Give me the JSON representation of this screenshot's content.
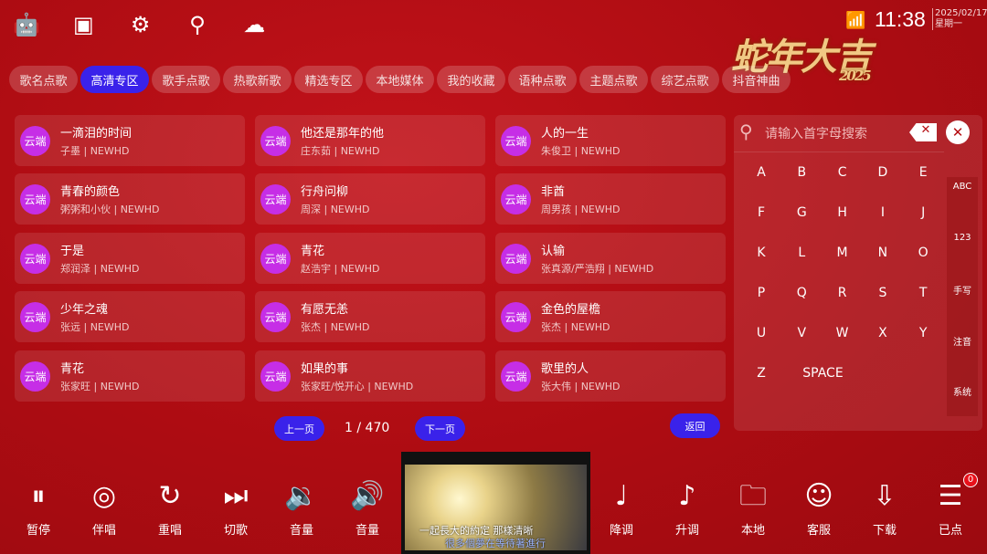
{
  "status": {
    "time": "11:38",
    "date": "2025/02/17",
    "weekday": "星期一"
  },
  "logo": {
    "text": "蛇年大吉",
    "year": "2025"
  },
  "top_icons": [
    "android-icon",
    "cube-icon",
    "gear-icon",
    "search-icon",
    "cloud-download-icon"
  ],
  "tabs": [
    {
      "label": "歌名点歌"
    },
    {
      "label": "高清专区",
      "active": true
    },
    {
      "label": "歌手点歌"
    },
    {
      "label": "热歌新歌"
    },
    {
      "label": "精选专区"
    },
    {
      "label": "本地媒体"
    },
    {
      "label": "我的收藏"
    },
    {
      "label": "语种点歌"
    },
    {
      "label": "主题点歌"
    },
    {
      "label": "综艺点歌"
    },
    {
      "label": "抖音神曲"
    }
  ],
  "badge_label": "云端",
  "songs": [
    {
      "title": "一滴泪的时间",
      "sub": "子墨 | NEWHD"
    },
    {
      "title": "他还是那年的他",
      "sub": "庄东茹 | NEWHD"
    },
    {
      "title": "人的一生",
      "sub": "朱俊卫 | NEWHD"
    },
    {
      "title": "青春的颜色",
      "sub": "粥粥和小伙 | NEWHD"
    },
    {
      "title": "行舟问柳",
      "sub": "周深 | NEWHD"
    },
    {
      "title": "非酋",
      "sub": "周男孩 | NEWHD"
    },
    {
      "title": "于是",
      "sub": "郑润泽 | NEWHD"
    },
    {
      "title": "青花",
      "sub": "赵浩宇 | NEWHD"
    },
    {
      "title": "认输",
      "sub": "张真源/严浩翔 | NEWHD"
    },
    {
      "title": "少年之魂",
      "sub": "张远 | NEWHD"
    },
    {
      "title": "有愿无恙",
      "sub": "张杰 | NEWHD"
    },
    {
      "title": "金色的屋檐",
      "sub": "张杰 | NEWHD"
    },
    {
      "title": "青花",
      "sub": "张家旺 | NEWHD"
    },
    {
      "title": "如果的事",
      "sub": "张家旺/悦开心 | NEWHD"
    },
    {
      "title": "歌里的人",
      "sub": "张大伟 | NEWHD"
    }
  ],
  "search": {
    "placeholder": "请输入首字母搜索",
    "keys": [
      "A",
      "B",
      "C",
      "D",
      "E",
      "F",
      "G",
      "H",
      "I",
      "J",
      "K",
      "L",
      "M",
      "N",
      "O",
      "P",
      "Q",
      "R",
      "S",
      "T",
      "U",
      "V",
      "W",
      "X",
      "Y",
      "Z"
    ],
    "space": "SPACE",
    "modes": [
      "ABC",
      "123",
      "手写",
      "注音",
      "系统"
    ]
  },
  "pagination": {
    "prev": "上一页",
    "next": "下一页",
    "current": "1",
    "total": "470",
    "back": "返回"
  },
  "video": {
    "lyric1": "一起長大的約定 那樣清晰",
    "lyric2": "很多個夢在等待著進行"
  },
  "controls": [
    {
      "label": "暂停",
      "icon": "pause-icon",
      "glyph": "⏸"
    },
    {
      "label": "伴唱",
      "icon": "disc-icon",
      "glyph": "◎"
    },
    {
      "label": "重唱",
      "icon": "replay-icon",
      "glyph": "↻"
    },
    {
      "label": "切歌",
      "icon": "skip-icon",
      "glyph": "⏭"
    },
    {
      "label": "音量",
      "icon": "volume-down-icon",
      "glyph": "🔉"
    },
    {
      "label": "音量",
      "icon": "volume-up-icon",
      "glyph": "🔊"
    },
    {
      "label": "降调",
      "icon": "note-down-icon",
      "glyph": "♩"
    },
    {
      "label": "升调",
      "icon": "note-up-icon",
      "glyph": "♪"
    },
    {
      "label": "本地",
      "icon": "folder-icon",
      "glyph": "🗀"
    },
    {
      "label": "客服",
      "icon": "support-icon",
      "glyph": "☺"
    },
    {
      "label": "下载",
      "icon": "cloud-download-icon",
      "glyph": "⇩"
    },
    {
      "label": "已点",
      "icon": "playlist-icon",
      "glyph": "☰"
    }
  ],
  "queue_count": "0",
  "colors": {
    "background": "#b50d12",
    "accent": "#3a22ea",
    "badge": "#c62ee6",
    "logo": "#f1c984"
  }
}
